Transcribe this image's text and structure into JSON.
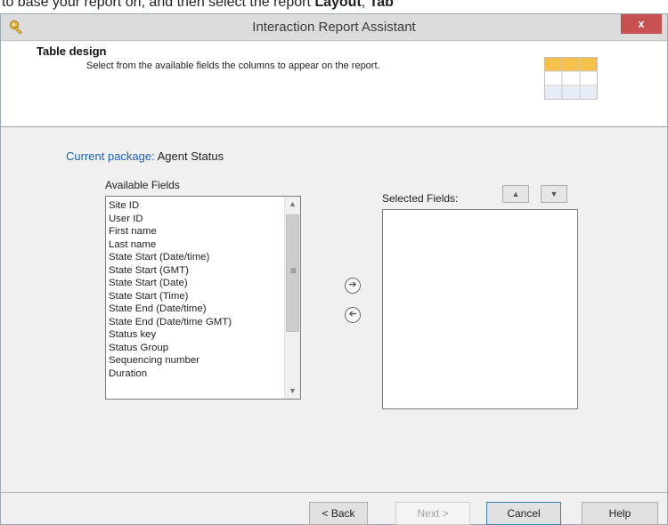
{
  "top_caption": {
    "text": "to base your report on, and then select the report ",
    "bold1": "Layout",
    "sep": ", ",
    "bold2": "Tab"
  },
  "window": {
    "title": "Interaction Report Assistant",
    "close_label": "x"
  },
  "header": {
    "title": "Table design",
    "description": "Select from the available fields the columns to appear on the report."
  },
  "package": {
    "label": "Current package:",
    "value": "Agent Status"
  },
  "available_fields": {
    "label": "Available Fields",
    "items": [
      "Site ID",
      "User ID",
      "First name",
      "Last name",
      "State Start (Date/time)",
      "State Start (GMT)",
      "State Start (Date)",
      "State Start (Time)",
      "State End (Date/time)",
      "State End (Date/time GMT)",
      "Status key",
      "Status Group",
      "Sequencing number",
      "Duration"
    ]
  },
  "selected_fields": {
    "label": "Selected Fields:",
    "items": []
  },
  "buttons": {
    "back": "< Back",
    "next": "Next >",
    "cancel": "Cancel",
    "help": "Help"
  },
  "colors": {
    "accent": "#1d60c4",
    "close": "#c75050"
  },
  "icons": {
    "app": "key-icon",
    "header": "table-icon",
    "add": "arrow-right-circle-icon",
    "remove": "arrow-left-circle-icon",
    "up": "triangle-up-icon",
    "down": "triangle-down-icon"
  }
}
